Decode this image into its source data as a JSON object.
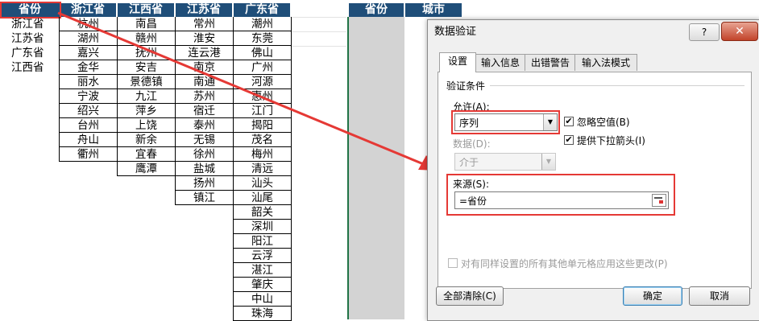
{
  "sheet": {
    "headers": {
      "province": "省份",
      "zhejiang": "浙江省",
      "jiangxi": "江西省",
      "jiangsu": "江苏省",
      "guangdong": "广东省",
      "target_province": "省份",
      "target_city": "城市"
    },
    "provinces": [
      "浙江省",
      "江苏省",
      "广东省",
      "江西省"
    ],
    "zhejiang": [
      "杭州",
      "湖州",
      "嘉兴",
      "金华",
      "丽水",
      "宁波",
      "绍兴",
      "台州",
      "舟山",
      "衢州"
    ],
    "jiangxi": [
      "南昌",
      "赣州",
      "抚州",
      "安吉",
      "景德镇",
      "九江",
      "萍乡",
      "上饶",
      "新余",
      "宜春",
      "鹰潭"
    ],
    "jiangsu": [
      "常州",
      "淮安",
      "连云港",
      "南京",
      "南通",
      "苏州",
      "宿迁",
      "泰州",
      "无锡",
      "徐州",
      "盐城",
      "扬州",
      "镇江"
    ],
    "guangdong": [
      "潮州",
      "东莞",
      "佛山",
      "广州",
      "河源",
      "惠州",
      "江门",
      "揭阳",
      "茂名",
      "梅州",
      "清远",
      "汕头",
      "汕尾",
      "韶关",
      "深圳",
      "阳江",
      "云浮",
      "湛江",
      "肇庆",
      "中山",
      "珠海"
    ],
    "colors": {
      "header_bg": "#1f4e79",
      "arrow": "#e53935",
      "highlight": "#e53935"
    }
  },
  "dialog": {
    "title": "数据验证",
    "help": "?",
    "close": "✕",
    "tabs": [
      "设置",
      "输入信息",
      "出错警告",
      "输入法模式"
    ],
    "section": "验证条件",
    "allow_label": "允许(A):",
    "allow_value": "序列",
    "ignore_blank": "忽略空值(B)",
    "dropdown": "提供下拉箭头(I)",
    "data_label": "数据(D):",
    "data_value": "介于",
    "source_label": "来源(S):",
    "source_value": "=省份",
    "apply_all": "对有同样设置的所有其他单元格应用这些更改(P)",
    "clear_all": "全部清除(C)",
    "ok": "确定",
    "cancel": "取消"
  }
}
